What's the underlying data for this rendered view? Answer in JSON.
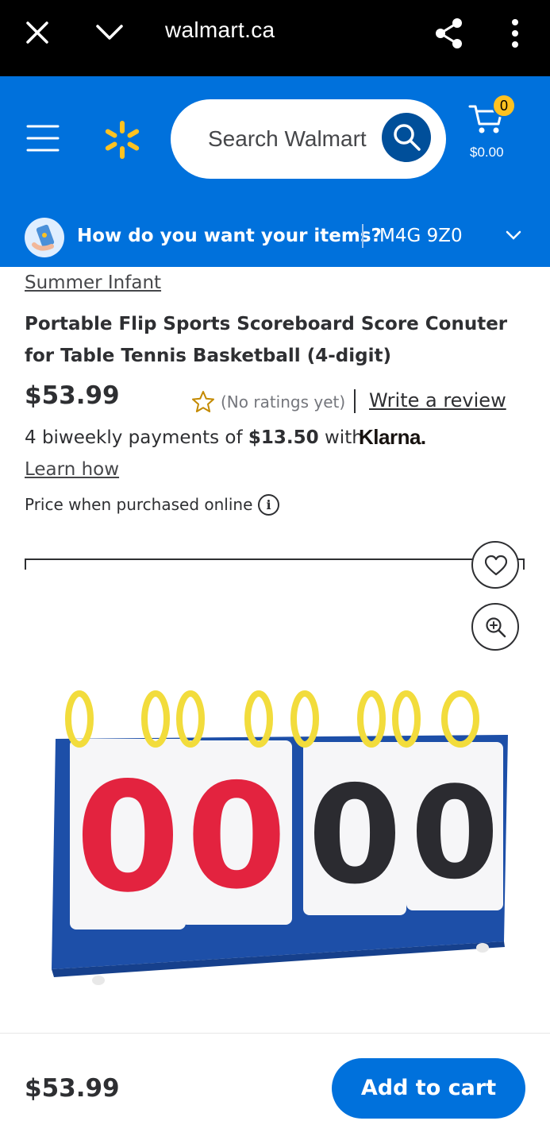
{
  "browser": {
    "url": "walmart.ca"
  },
  "header": {
    "search_placeholder": "Search Walmart",
    "cart_count": "0",
    "cart_total": "$0.00",
    "brand_color": "#0071dc",
    "spark_color": "#ffc220"
  },
  "delivery": {
    "question": "How do you want your items?",
    "postal_code": "M4G 9Z0"
  },
  "product": {
    "brand": "Summer Infant",
    "title": "Portable Flip Sports Scoreboard Score Conuter for Table Tennis Basketball (4-digit)",
    "price": "$53.99",
    "rating_text": "(No ratings yet)",
    "write_review": "Write a review",
    "klarna_prefix": "4 biweekly payments of",
    "klarna_amount": "$13.50",
    "klarna_with": "with",
    "klarna_brand": "Klarna.",
    "learn_how": "Learn how",
    "price_note": "Price when purchased online",
    "info_icon": "i",
    "image_digits": [
      "0",
      "0",
      "0",
      "0"
    ]
  },
  "bottom": {
    "price": "$53.99",
    "add_to_cart": "Add to cart"
  }
}
